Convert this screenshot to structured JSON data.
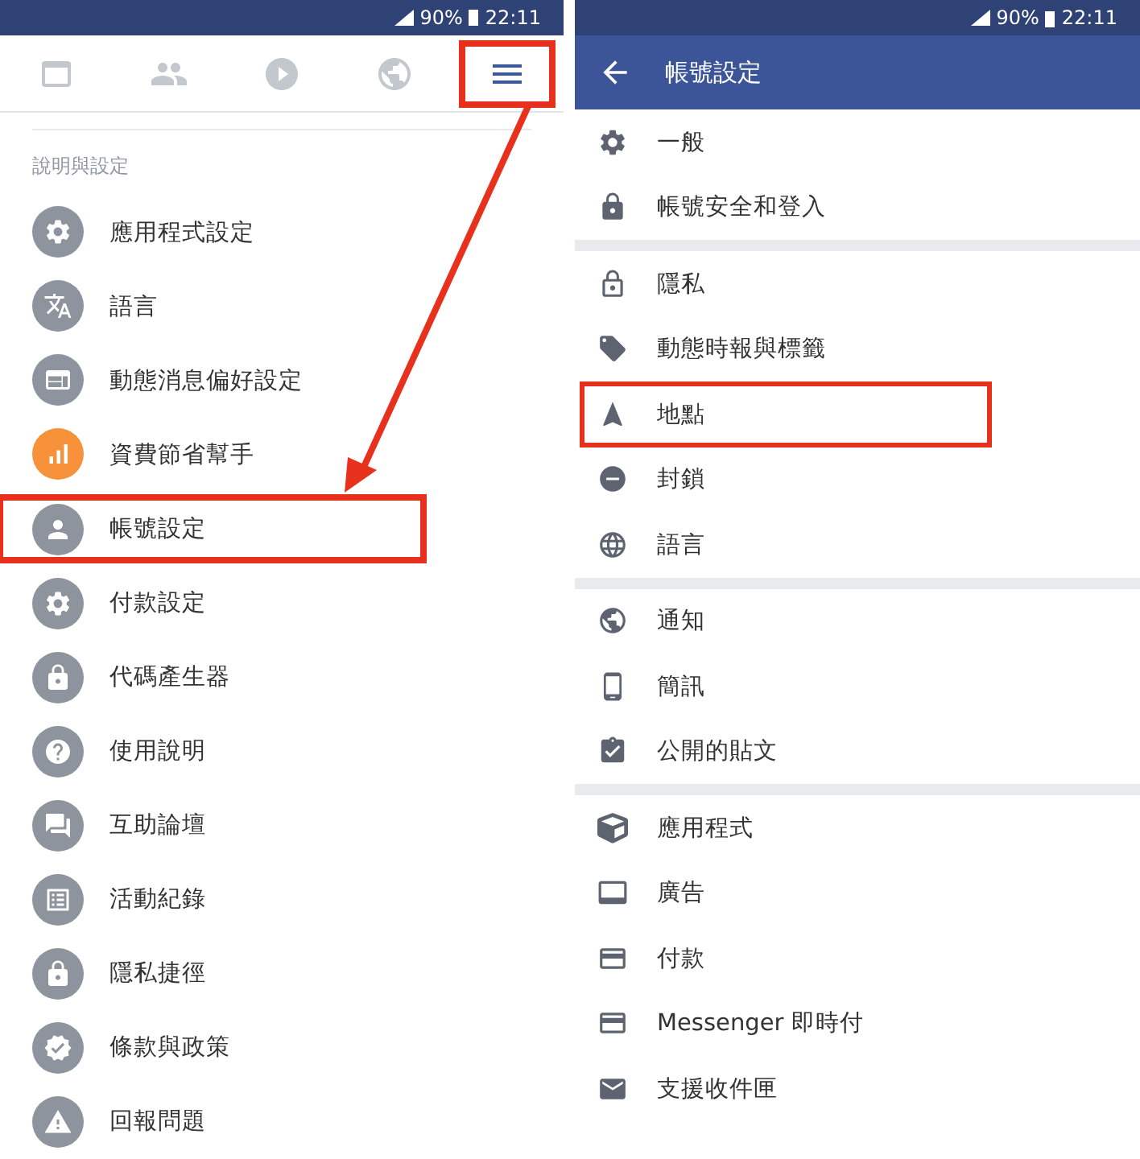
{
  "left": {
    "status_bar": {
      "battery": "90%",
      "time": "22:11"
    },
    "nav_tabs": [
      {
        "selected": false,
        "highlighted": false
      },
      {
        "selected": false,
        "highlighted": false
      },
      {
        "selected": false,
        "highlighted": false
      },
      {
        "selected": false,
        "highlighted": false
      },
      {
        "selected": true,
        "highlighted": true
      }
    ],
    "section_title": "說明與設定",
    "items": [
      {
        "label": "應用程式設定",
        "color": "#8d949e",
        "highlighted": false
      },
      {
        "label": "語言",
        "color": "#8d949e",
        "highlighted": false
      },
      {
        "label": "動態消息偏好設定",
        "color": "#8d949e",
        "highlighted": false
      },
      {
        "label": "資費節省幫手",
        "color": "#f7923b",
        "highlighted": false
      },
      {
        "label": "帳號設定",
        "color": "#8d949e",
        "highlighted": true
      },
      {
        "label": "付款設定",
        "color": "#8d949e",
        "highlighted": false
      },
      {
        "label": "代碼產生器",
        "color": "#8d949e",
        "highlighted": false
      },
      {
        "label": "使用說明",
        "color": "#8d949e",
        "highlighted": false
      },
      {
        "label": "互助論壇",
        "color": "#8d949e",
        "highlighted": false
      },
      {
        "label": "活動紀錄",
        "color": "#8d949e",
        "highlighted": false
      },
      {
        "label": "隱私捷徑",
        "color": "#8d949e",
        "highlighted": false
      },
      {
        "label": "條款與政策",
        "color": "#8d949e",
        "highlighted": false
      },
      {
        "label": "回報問題",
        "color": "#8d949e",
        "highlighted": false
      }
    ]
  },
  "right": {
    "status_bar": {
      "battery": "90%",
      "time": "22:11"
    },
    "title": "帳號設定",
    "groups": [
      {
        "items": [
          {
            "label": "一般",
            "highlighted": false
          },
          {
            "label": "帳號安全和登入",
            "highlighted": false
          }
        ]
      },
      {
        "items": [
          {
            "label": "隱私",
            "highlighted": false
          },
          {
            "label": "動態時報與標籤",
            "highlighted": false
          },
          {
            "label": "地點",
            "highlighted": true
          },
          {
            "label": "封鎖",
            "highlighted": false
          },
          {
            "label": "語言",
            "highlighted": false
          }
        ]
      },
      {
        "items": [
          {
            "label": "通知",
            "highlighted": false
          },
          {
            "label": "簡訊",
            "highlighted": false
          },
          {
            "label": "公開的貼文",
            "highlighted": false
          }
        ]
      },
      {
        "items": [
          {
            "label": "應用程式",
            "highlighted": false
          },
          {
            "label": "廣告",
            "highlighted": false
          },
          {
            "label": "付款",
            "highlighted": false
          },
          {
            "label": "Messenger 即時付",
            "highlighted": false
          },
          {
            "label": "支援收件匣",
            "highlighted": false
          }
        ]
      }
    ]
  }
}
